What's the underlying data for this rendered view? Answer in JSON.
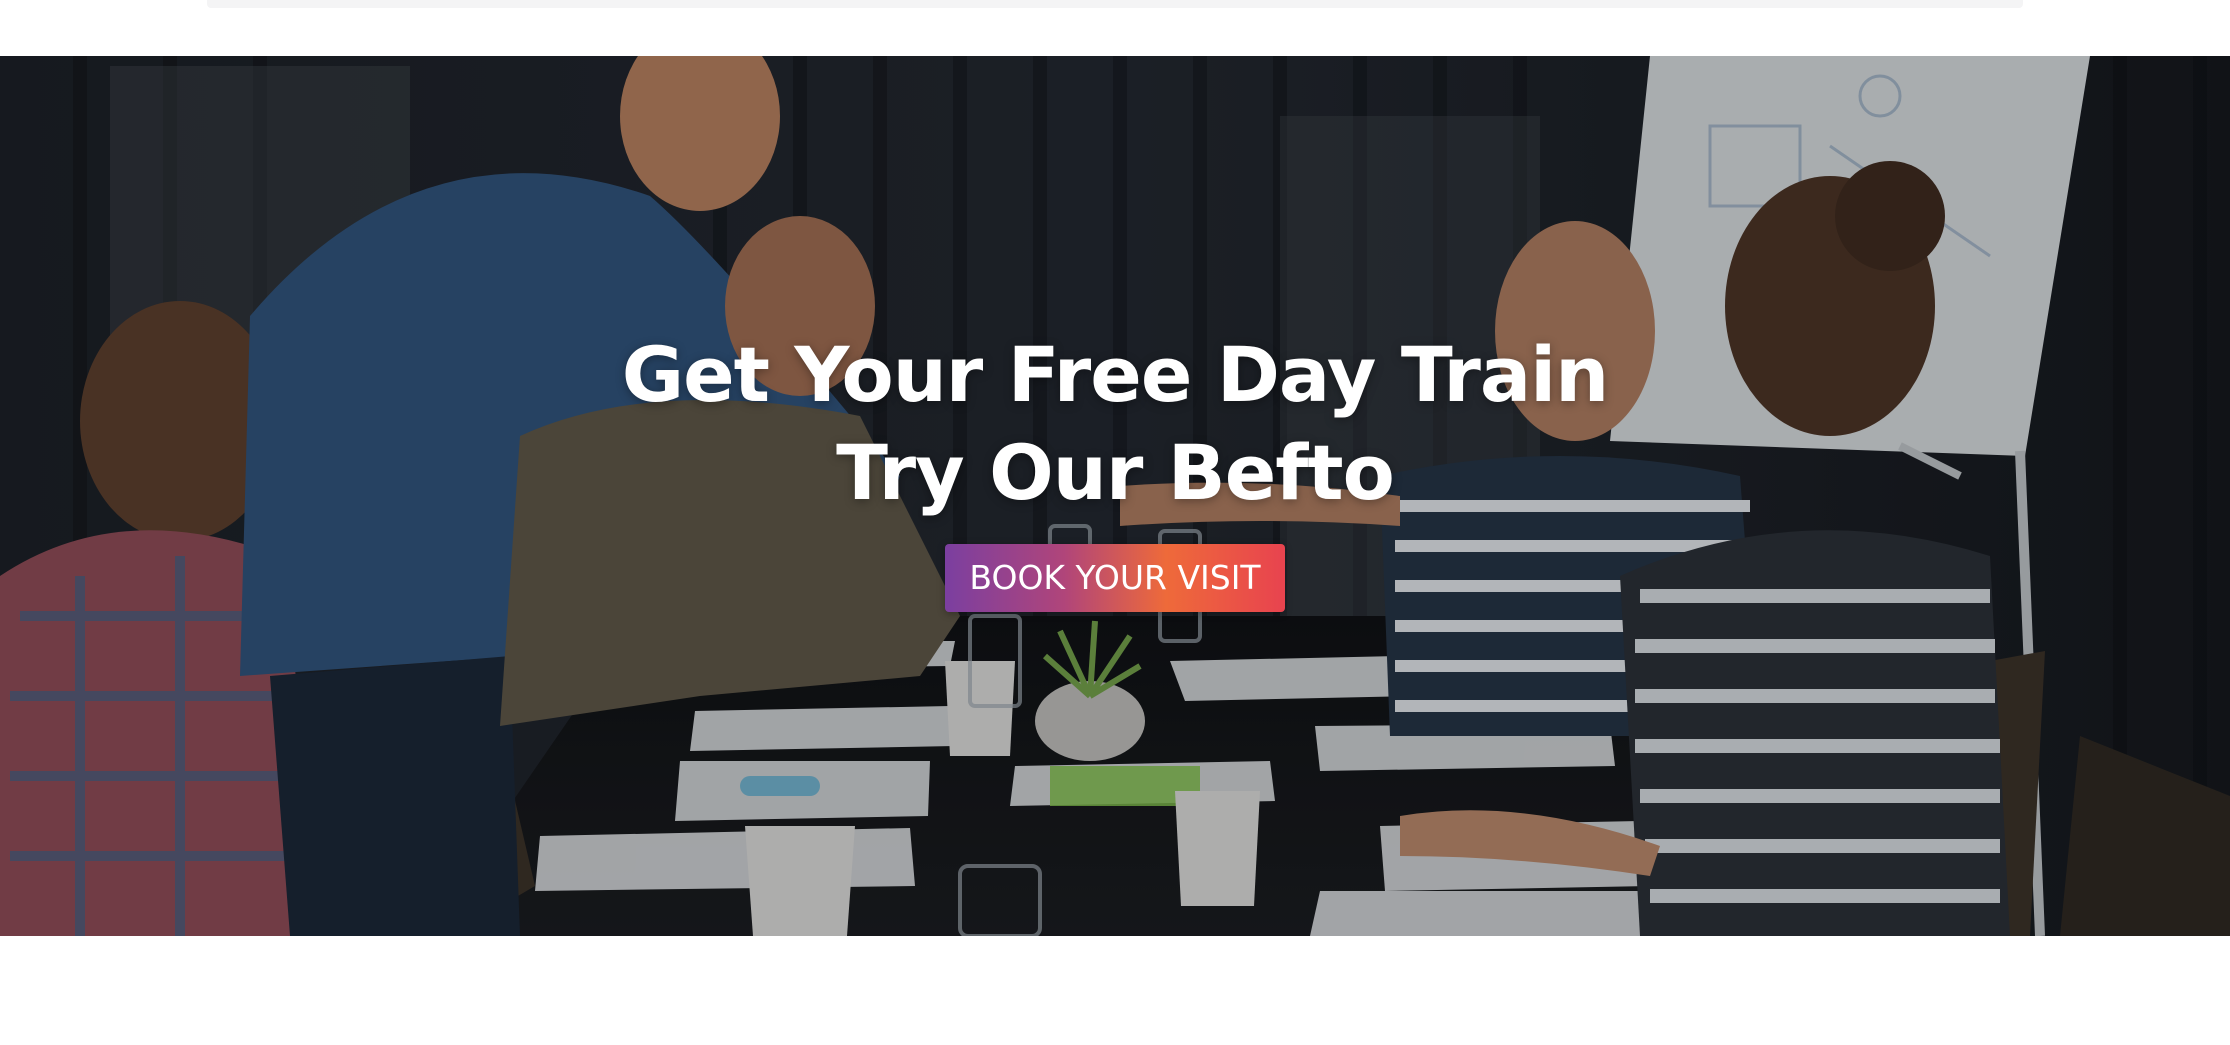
{
  "hero": {
    "title_line1": "Get Your Free Day Train",
    "title_line2": "Try Our Befto",
    "cta_label": "BOOK YOUR VISIT"
  },
  "colors": {
    "cta_gradient_start": "#7b3fa0",
    "cta_gradient_mid": "#ee6a3a",
    "cta_gradient_end": "#e8434f",
    "hero_text": "#ffffff"
  }
}
